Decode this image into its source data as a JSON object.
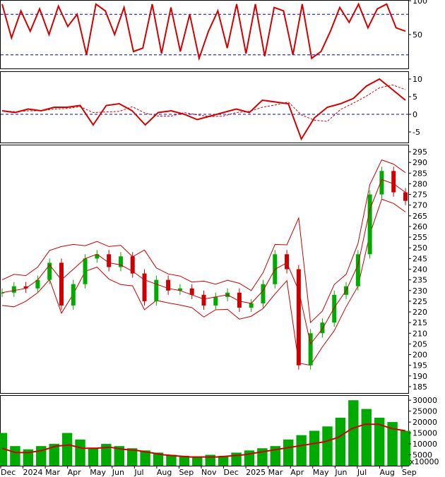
{
  "chart_data": [
    {
      "panel": "oscillator",
      "type": "line",
      "ylim": [
        0,
        100
      ],
      "y_ticks": [
        "100",
        "50"
      ],
      "y_tick_values": [
        100,
        50
      ],
      "reference_lines": [
        80,
        20
      ],
      "line_color": "#d40000",
      "reference_color": "#0000cc",
      "series": [
        {
          "values": [
            95,
            45,
            85,
            55,
            88,
            50,
            92,
            62,
            80,
            20,
            95,
            85,
            50,
            90,
            25,
            30,
            95,
            22,
            90,
            25,
            80,
            15,
            55,
            85,
            30,
            95,
            22,
            95,
            18,
            90,
            85,
            20,
            95,
            15,
            25,
            55,
            90,
            68,
            95,
            60,
            88,
            95,
            60,
            55
          ]
        }
      ]
    },
    {
      "panel": "momentum",
      "type": "line",
      "ylim": [
        -8,
        12
      ],
      "y_ticks": [
        "10",
        "5",
        "0",
        "-5"
      ],
      "y_tick_values": [
        10,
        5,
        0,
        -5
      ],
      "reference_lines": [
        0
      ],
      "line_color": "#d40000",
      "reference_color": "#0000cc",
      "series": [
        {
          "values": [
            1,
            0.5,
            1.5,
            1,
            2,
            2,
            2.5,
            -3,
            2.5,
            3,
            1,
            -3,
            0.5,
            1,
            0,
            -1.5,
            -0.5,
            0.5,
            1.5,
            0.5,
            4,
            3.5,
            3,
            -7,
            -1,
            2,
            3,
            4.5,
            8,
            10,
            7,
            4
          ]
        }
      ]
    },
    {
      "panel": "price",
      "type": "candlestick",
      "ylim": [
        182,
        298
      ],
      "y_ticks": [
        "295",
        "290",
        "285",
        "280",
        "275",
        "270",
        "265",
        "260",
        "255",
        "250",
        "245",
        "240",
        "235",
        "230",
        "225",
        "220",
        "215",
        "210",
        "205",
        "200",
        "195",
        "190",
        "185"
      ],
      "y_tick_values": [
        295,
        290,
        285,
        280,
        275,
        270,
        265,
        260,
        255,
        250,
        245,
        240,
        235,
        230,
        225,
        220,
        215,
        210,
        205,
        200,
        195,
        190,
        185
      ],
      "x_labels": [
        "Dec",
        "2024",
        "Mar",
        "Apr",
        "May",
        "Jun",
        "Jul",
        "Aug",
        "Sep",
        "Nov",
        "Dec",
        "2025",
        "Mar",
        "Apr",
        "May",
        "Jun",
        "Jul",
        "Aug",
        "Sep"
      ],
      "series": [
        {
          "values": [
            229,
            232,
            231,
            235,
            243,
            223,
            233,
            245,
            247,
            241,
            246,
            238,
            225,
            235,
            230,
            231,
            228,
            223,
            227,
            229,
            222,
            224,
            233,
            247,
            240,
            195,
            210,
            215,
            228,
            232,
            247,
            275,
            286,
            276,
            272
          ]
        },
        {
          "values": [
            229,
            230,
            231,
            235,
            242,
            235,
            240,
            245,
            247,
            243,
            242,
            239,
            235,
            233,
            231,
            230,
            228,
            226,
            227,
            228,
            225,
            224,
            230,
            240,
            243,
            230,
            205,
            212,
            222,
            230,
            242,
            268,
            282,
            280,
            276
          ]
        }
      ],
      "colors": {
        "up": "#00aa00",
        "down": "#cc0000",
        "band": "#cc0000",
        "ma": "#cc0000"
      }
    },
    {
      "panel": "volume",
      "type": "bar",
      "ylim": [
        0,
        32000
      ],
      "y_ticks": [
        "30000",
        "25000",
        "20000",
        "15000",
        "10000",
        "5000"
      ],
      "y_tick_values": [
        30000,
        25000,
        20000,
        15000,
        10000,
        5000
      ],
      "unit_label": "x10000",
      "series": [
        {
          "values": [
            15000,
            9000,
            7500,
            9000,
            10000,
            15000,
            12000,
            8000,
            10000,
            9000,
            8000,
            7000,
            6000,
            5000,
            4500,
            4000,
            5000,
            4500,
            6000,
            7000,
            8000,
            9000,
            12000,
            14000,
            16000,
            18000,
            22000,
            30000,
            26000,
            22000,
            20000,
            16000
          ]
        },
        {
          "values": [
            8000,
            6000,
            6000,
            7000,
            9000,
            9500,
            8000,
            8000,
            8500,
            7500,
            7000,
            6000,
            5000,
            4500,
            4000,
            4000,
            4000,
            4500,
            5000,
            6000,
            7000,
            8000,
            9000,
            10000,
            11000,
            13000,
            17000,
            19000,
            19000,
            17000,
            16000
          ]
        }
      ],
      "colors": {
        "bars": "#00aa00",
        "ma": "#cc0000"
      }
    }
  ]
}
